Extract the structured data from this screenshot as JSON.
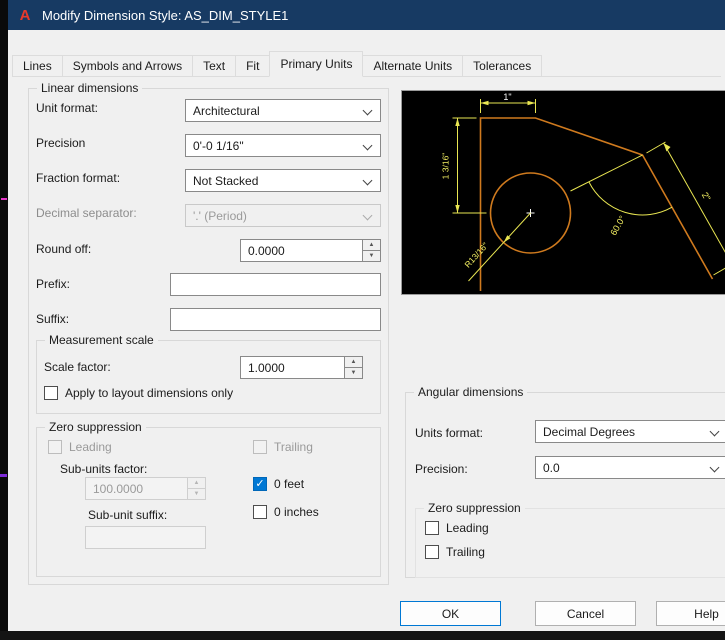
{
  "window": {
    "title": "Modify Dimension Style: AS_DIM_STYLE1",
    "icon_glyph": "A"
  },
  "tabs": [
    {
      "label": "Lines"
    },
    {
      "label": "Symbols and Arrows"
    },
    {
      "label": "Text"
    },
    {
      "label": "Fit"
    },
    {
      "label": "Primary Units",
      "active": true
    },
    {
      "label": "Alternate Units"
    },
    {
      "label": "Tolerances"
    }
  ],
  "linear": {
    "group_label": "Linear dimensions",
    "unit_format_label": "Unit format:",
    "unit_format_value": "Architectural",
    "precision_label": "Precision",
    "precision_value": "0'-0 1/16\"",
    "fraction_label": "Fraction format:",
    "fraction_value": "Not Stacked",
    "decimal_sep_label": "Decimal separator:",
    "decimal_sep_value": "'.' (Period)",
    "round_off_label": "Round off:",
    "round_off_value": "0.0000",
    "prefix_label": "Prefix:",
    "prefix_value": "",
    "suffix_label": "Suffix:",
    "suffix_value": ""
  },
  "measurement_scale": {
    "group_label": "Measurement scale",
    "scale_factor_label": "Scale factor:",
    "scale_factor_value": "1.0000",
    "apply_layout_label": "Apply to layout dimensions only",
    "apply_layout_checked": false
  },
  "zero_suppression": {
    "group_label": "Zero suppression",
    "leading_label": "Leading",
    "leading_checked": false,
    "trailing_label": "Trailing",
    "trailing_checked": false,
    "sub_units_factor_label": "Sub-units factor:",
    "sub_units_factor_value": "100.0000",
    "zero_feet_label": "0 feet",
    "zero_feet_checked": true,
    "sub_unit_suffix_label": "Sub-unit suffix:",
    "sub_unit_suffix_value": "",
    "zero_inches_label": "0 inches",
    "zero_inches_checked": false
  },
  "preview": {
    "dim_top": "1\"",
    "dim_left": "1 3/16\"",
    "dim_right": "2\"",
    "dim_angle": "60.0°",
    "dim_radius": "R13/16\""
  },
  "angular": {
    "group_label": "Angular dimensions",
    "units_format_label": "Units format:",
    "units_format_value": "Decimal Degrees",
    "precision_label": "Precision:",
    "precision_value": "0.0",
    "zero_suppression_label": "Zero suppression",
    "leading_label": "Leading",
    "leading_checked": false,
    "trailing_label": "Trailing",
    "trailing_checked": false
  },
  "buttons": {
    "ok": "OK",
    "cancel": "Cancel",
    "help": "Help"
  }
}
